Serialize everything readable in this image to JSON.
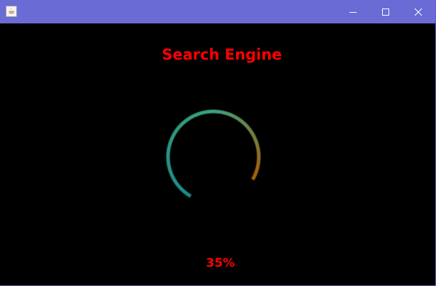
{
  "window": {
    "title": "",
    "app_icon": "java-coffee-icon",
    "controls": {
      "minimize": "minimize-icon",
      "maximize": "maximize-icon",
      "close": "close-icon"
    }
  },
  "main": {
    "title": "Search Engine",
    "progress": {
      "value": 0.35,
      "label": "35%"
    }
  },
  "colors": {
    "titlebar": "#6b6bd6",
    "background": "#000000",
    "text_accent": "#ff0000",
    "arc_teal": "#1c8a8a",
    "arc_green": "#3aa37e",
    "arc_orange": "#a85f08"
  }
}
